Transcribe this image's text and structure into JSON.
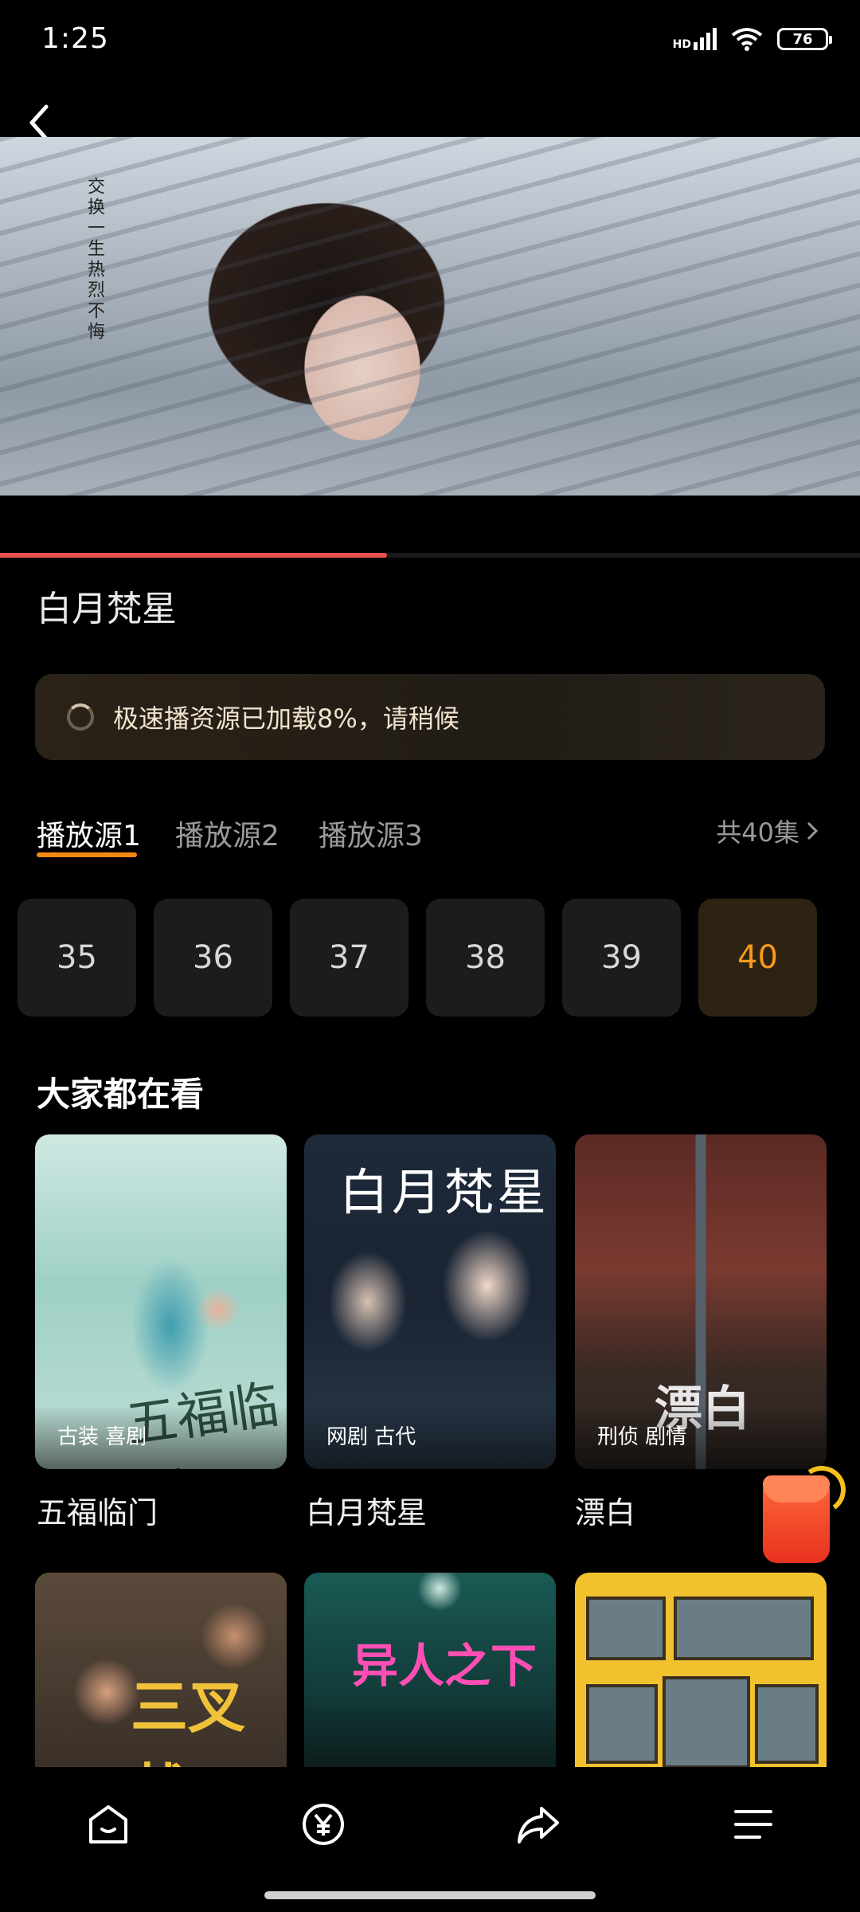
{
  "status_bar": {
    "time": "1:25",
    "network": "HD",
    "battery": "76"
  },
  "video": {
    "caption": "交换一生热烈不悔",
    "progress_percent": 45
  },
  "show": {
    "title": "白月梵星"
  },
  "notice": {
    "text": "极速播资源已加载8%，请稍候"
  },
  "sources": {
    "tabs": [
      "播放源1",
      "播放源2",
      "播放源3"
    ],
    "active_index": 0,
    "total": "共40集"
  },
  "episodes": {
    "items": [
      "35",
      "36",
      "37",
      "38",
      "39",
      "40"
    ],
    "active": "40"
  },
  "recommend": {
    "heading": "大家都在看",
    "items": [
      {
        "title": "五福临门",
        "tags": "古装 喜剧",
        "poster_text": "五福临门"
      },
      {
        "title": "白月梵星",
        "tags": "网剧 古代",
        "poster_text": "白月梵星"
      },
      {
        "title": "漂白",
        "tags": "刑侦 剧情",
        "poster_text": "漂白"
      }
    ],
    "row2": [
      {
        "poster_text": "三叉戟"
      },
      {
        "poster_text": "异人之下"
      },
      {
        "poster_text": ""
      }
    ]
  },
  "bottom_nav": [
    "home-icon",
    "coin-icon",
    "share-icon",
    "menu-icon"
  ],
  "colors": {
    "accent": "#f28a13",
    "progress": "#e8524a",
    "active_episode": "#f59a1d"
  }
}
